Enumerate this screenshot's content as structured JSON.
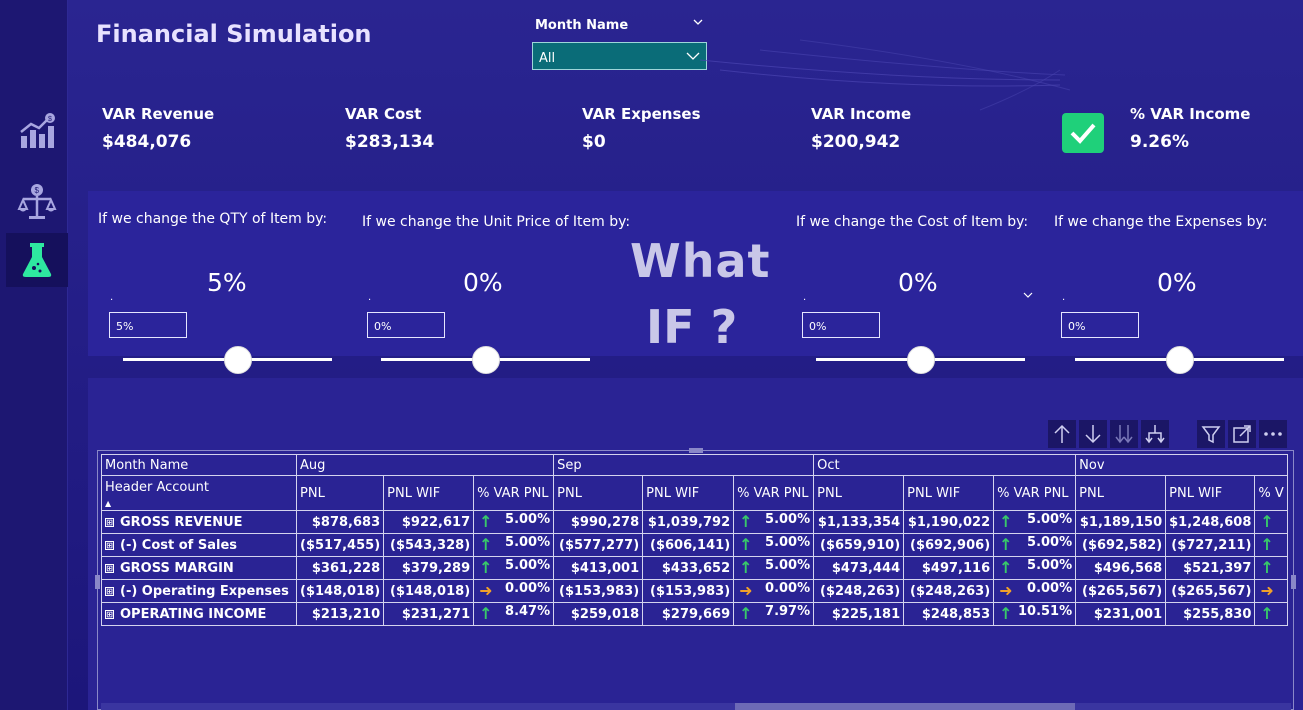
{
  "title": "Financial Simulation",
  "slicer": {
    "label": "Month Name",
    "value": "All"
  },
  "kpis": [
    {
      "label": "VAR Revenue",
      "value": "$484,076"
    },
    {
      "label": "VAR Cost",
      "value": "$283,134"
    },
    {
      "label": "VAR Expenses",
      "value": "$0"
    },
    {
      "label": "VAR Income",
      "value": "$200,942"
    },
    {
      "label": "% VAR Income",
      "value": "9.26%"
    }
  ],
  "whatif": {
    "line1": "What",
    "line2": "IF",
    "qmark": "?"
  },
  "params": [
    {
      "label": "If we change the QTY of Item by:",
      "value": "5%",
      "input": "5%",
      "dot": ".",
      "level": 0.55
    },
    {
      "label": "If we change the Unit Price of Item by:",
      "value": "0%",
      "input": "0%",
      "dot": ".",
      "level": 0.5
    },
    {
      "label": "If we change the Cost of Item by:",
      "value": "0%",
      "input": "0%",
      "dot": ".",
      "level": 0.5
    },
    {
      "label": "If we change the Expenses by:",
      "value": "0%",
      "input": "0%",
      "dot": ".",
      "level": 0.5
    }
  ],
  "matrix": {
    "row_header": "Header Account",
    "col_header": "Month Name",
    "months": [
      "Aug",
      "Sep",
      "Oct",
      "Nov"
    ],
    "measures": [
      "PNL",
      "PNL WIF",
      "% VAR PNL",
      "PNL",
      "PNL WIF",
      "% VAR PNL",
      "PNL",
      "PNL WIF",
      "% VAR PNL",
      "PNL",
      "PNL WIF",
      "% V"
    ],
    "expand_glyph": "⊞",
    "rows": [
      {
        "label": "GROSS REVENUE",
        "cells": [
          "$878,683",
          "$922,617",
          "5.00%",
          "$990,278",
          "$1,039,792",
          "5.00%",
          "$1,133,354",
          "$1,190,022",
          "5.00%",
          "$1,189,150",
          "$1,248,608",
          ""
        ],
        "arrow": "up"
      },
      {
        "label": "(-) Cost of Sales",
        "cells": [
          "($517,455)",
          "($543,328)",
          "5.00%",
          "($577,277)",
          "($606,141)",
          "5.00%",
          "($659,910)",
          "($692,906)",
          "5.00%",
          "($692,582)",
          "($727,211)",
          ""
        ],
        "arrow": "up"
      },
      {
        "label": "GROSS MARGIN",
        "cells": [
          "$361,228",
          "$379,289",
          "5.00%",
          "$413,001",
          "$433,652",
          "5.00%",
          "$473,444",
          "$497,116",
          "5.00%",
          "$496,568",
          "$521,397",
          ""
        ],
        "arrow": "up"
      },
      {
        "label": "(-) Operating Expenses",
        "cells": [
          "($148,018)",
          "($148,018)",
          "0.00%",
          "($153,983)",
          "($153,983)",
          "0.00%",
          "($248,263)",
          "($248,263)",
          "0.00%",
          "($265,567)",
          "($265,567)",
          ""
        ],
        "arrow": "flat"
      },
      {
        "label": "OPERATING INCOME",
        "cells": [
          "$213,210",
          "$231,271",
          "8.47%",
          "$259,018",
          "$279,669",
          "7.97%",
          "$225,181",
          "$248,853",
          "10.51%",
          "$231,001",
          "$255,830",
          ""
        ],
        "arrow": "up"
      }
    ]
  },
  "colors": {
    "accent": "#1fd07a",
    "up_arrow": "#38c96a",
    "flat_arrow": "#f0a02a",
    "slicer_bg": "#0a6c78",
    "panel": "#2b249b"
  }
}
